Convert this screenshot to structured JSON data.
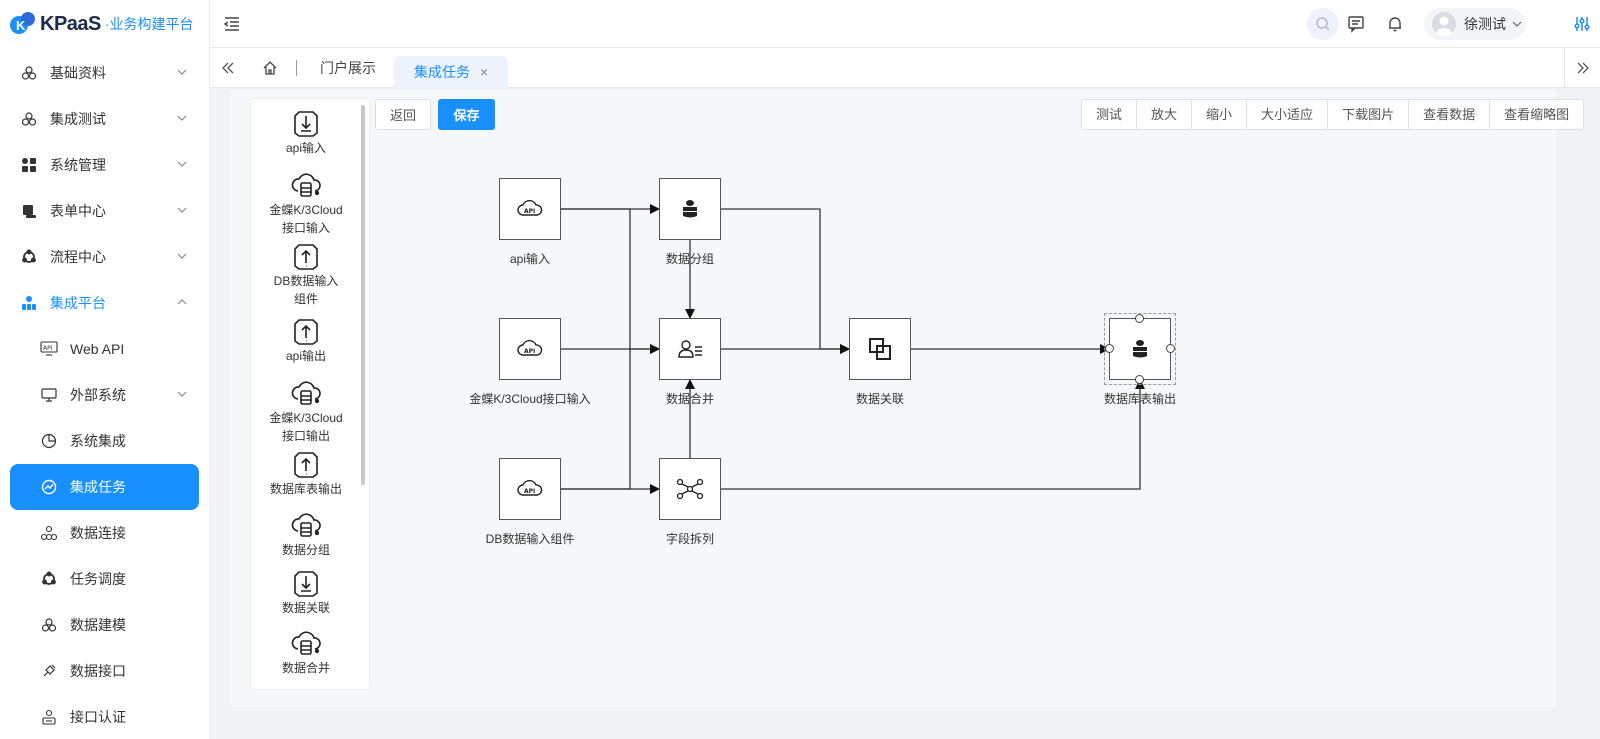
{
  "app": {
    "brand": "KPaaS",
    "subtitle": "·业务构建平台"
  },
  "sidebar": {
    "items": [
      {
        "label": "基础资料",
        "icon": "cubes-icon"
      },
      {
        "label": "集成测试",
        "icon": "cubes-icon"
      },
      {
        "label": "系统管理",
        "icon": "grid-icon"
      },
      {
        "label": "表单中心",
        "icon": "form-icon"
      },
      {
        "label": "流程中心",
        "icon": "cycle-icon"
      },
      {
        "label": "集成平台",
        "icon": "network-icon"
      },
      {
        "label": "Web API",
        "icon": "api-icon"
      },
      {
        "label": "外部系统",
        "icon": "monitor-icon"
      },
      {
        "label": "系统集成",
        "icon": "pie-icon"
      },
      {
        "label": "集成任务",
        "icon": "task-icon"
      },
      {
        "label": "数据连接",
        "icon": "connect-icon"
      },
      {
        "label": "任务调度",
        "icon": "cycle-icon"
      },
      {
        "label": "数据建模",
        "icon": "cubes-icon"
      },
      {
        "label": "数据接口",
        "icon": "plug-icon"
      },
      {
        "label": "接口认证",
        "icon": "auth-icon"
      }
    ]
  },
  "header": {
    "user_name": "徐测试"
  },
  "tabs": {
    "portal": "门户展示",
    "active": "集成任务",
    "close": "×"
  },
  "toolbar": {
    "back": "返回",
    "save": "保存",
    "tools": [
      "测试",
      "放大",
      "缩小",
      "大小适应",
      "下载图片",
      "查看数据",
      "查看缩略图"
    ]
  },
  "palette": [
    {
      "line1": "api输入",
      "line2": "",
      "icon": "download-doc-icon"
    },
    {
      "line1": "金蝶K/3Cloud",
      "line2": "接口输入",
      "icon": "cloud-db-icon"
    },
    {
      "line1": "DB数据输入",
      "line2": "组件",
      "icon": "upload-doc-icon"
    },
    {
      "line1": "api输出",
      "line2": "",
      "icon": "upload-doc-icon"
    },
    {
      "line1": "金蝶K/3Cloud",
      "line2": "接口输出",
      "icon": "cloud-db-icon"
    },
    {
      "line1": "数据库表输出",
      "line2": "",
      "icon": "upload-doc-icon"
    },
    {
      "line1": "数据分组",
      "line2": "",
      "icon": "cloud-db-icon"
    },
    {
      "line1": "数据关联",
      "line2": "",
      "icon": "download-doc-icon"
    },
    {
      "line1": "数据合并",
      "line2": "",
      "icon": "cloud-db-icon"
    }
  ],
  "diagram": {
    "nodes": {
      "api_in": {
        "label": "api输入",
        "icon": "api-cloud-icon"
      },
      "k3_in": {
        "label": "金蝶K/3Cloud接口输入",
        "icon": "api-cloud-icon"
      },
      "db_in": {
        "label": "DB数据输入组件",
        "icon": "api-cloud-icon"
      },
      "group": {
        "label": "数据分组",
        "icon": "database-icon"
      },
      "merge": {
        "label": "数据合并",
        "icon": "user-list-icon"
      },
      "split": {
        "label": "字段拆列",
        "icon": "split-icon"
      },
      "join": {
        "label": "数据关联",
        "icon": "join-icon"
      },
      "db_out": {
        "label": "数据库表输出",
        "icon": "database-icon"
      }
    }
  }
}
